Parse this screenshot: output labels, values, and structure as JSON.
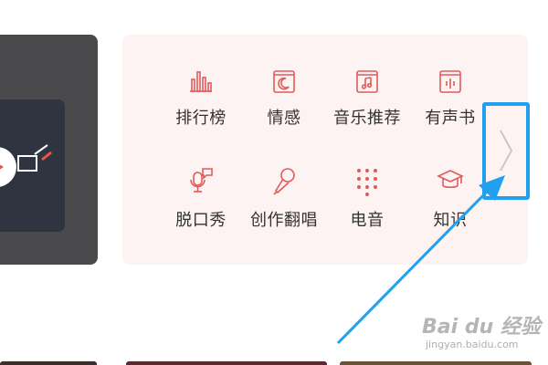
{
  "categories": [
    {
      "label": "排行榜",
      "icon": "chart-bars-icon"
    },
    {
      "label": "情感",
      "icon": "moon-book-icon"
    },
    {
      "label": "音乐推荐",
      "icon": "music-note-book-icon"
    },
    {
      "label": "有声书",
      "icon": "audio-book-icon"
    },
    {
      "label": "脱口秀",
      "icon": "talk-show-mic-icon"
    },
    {
      "label": "创作翻唱",
      "icon": "microphone-icon"
    },
    {
      "label": "电音",
      "icon": "dot-grid-icon"
    },
    {
      "label": "知识",
      "icon": "graduation-cap-icon"
    }
  ],
  "next_button": {
    "icon": "chevron-right-icon"
  },
  "colors": {
    "accent": "#e05a5a",
    "highlight": "#22a0f0",
    "panel_bg": "#fdf3f2"
  },
  "watermark": {
    "logo": "Bai du 经验",
    "url": "jingyan.baidu.com"
  }
}
